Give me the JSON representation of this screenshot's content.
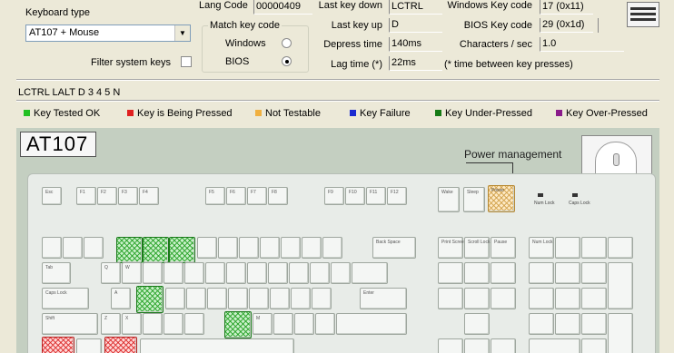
{
  "header": {
    "keyboard_type_label": "Keyboard type",
    "keyboard_type_value": "AT107 + Mouse",
    "filter_label": "Filter system keys",
    "filter_checked": false,
    "match_group_label": "Match key code",
    "match_options": [
      "Windows",
      "BIOS"
    ],
    "match_selected": "BIOS",
    "lang_code_label": "Lang Code",
    "lang_code_value": "00000409",
    "last_key_down_label": "Last key down",
    "last_key_down_value": "LCTRL",
    "last_key_up_label": "Last key up",
    "last_key_up_value": "D",
    "depress_time_label": "Depress time",
    "depress_time_value": "140ms",
    "lag_time_label": "Lag time (*)",
    "lag_time_value": "22ms",
    "windows_key_code_label": "Windows Key code",
    "windows_key_code_value": "17 (0x11)",
    "bios_key_code_label": "BIOS Key code",
    "bios_key_code_value": "29 (0x1d)",
    "chars_per_sec_label": "Characters / sec",
    "chars_per_sec_value": "1.0",
    "lag_note": "(* time between key presses)"
  },
  "key_history": "LCTRL LALT D 3 4 5 N",
  "legend": [
    {
      "label": "Key Tested OK",
      "color": "#22c022"
    },
    {
      "label": "Key is Being Pressed",
      "color": "#e02020"
    },
    {
      "label": "Not Testable",
      "color": "#f0b040"
    },
    {
      "label": "Key Failure",
      "color": "#1a2ad0"
    },
    {
      "label": "Key Under-Pressed",
      "color": "#157a15"
    },
    {
      "label": "Key Over-Pressed",
      "color": "#8a1a8a"
    }
  ],
  "keyboard": {
    "model_label": "AT107",
    "power_management_label": "Power management",
    "key_labels": {
      "esc": "Esc",
      "f1": "F1",
      "f2": "F2",
      "f3": "F3",
      "f4": "F4",
      "f5": "F5",
      "f6": "F6",
      "f7": "F7",
      "f8": "F8",
      "f9": "F9",
      "f10": "F10",
      "f11": "F11",
      "f12": "F12",
      "wake": "Wake",
      "sleep": "Sleep",
      "power": "Power",
      "backspace": "Back Space",
      "tab": "Tab",
      "caps": "Caps Lock",
      "enter": "Enter",
      "shift": "Shift",
      "q": "Q",
      "w": "W",
      "a": "A",
      "s": "S",
      "z": "Z",
      "x": "X",
      "m": "M",
      "print": "Print Screen",
      "scroll": "Scroll Lock",
      "pause": "Pause",
      "num": "Num Lock",
      "caps_led": "Caps Lock",
      "scroll_led": "Scroll Lock"
    }
  }
}
